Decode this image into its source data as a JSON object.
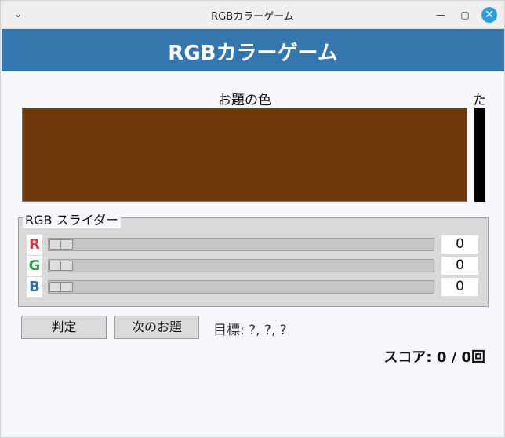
{
  "window": {
    "title": "RGBカラーゲーム",
    "menu_icon": "chevron-down-icon",
    "controls": [
      "minimize-icon",
      "maximize-icon",
      "close-icon"
    ]
  },
  "header": {
    "title": "RGBカラーゲーム"
  },
  "target": {
    "label": "お題の色",
    "color": "#6e3a07"
  },
  "side": {
    "label": "た",
    "color": "#000000"
  },
  "sliders": {
    "legend": "RGB スライダー",
    "channels": [
      {
        "letter": "R",
        "color": "#d9383e",
        "value": "0"
      },
      {
        "letter": "G",
        "color": "#2f9e4a",
        "value": "0"
      },
      {
        "letter": "B",
        "color": "#2f6fa8",
        "value": "0"
      }
    ]
  },
  "actions": {
    "judge_label": "判定",
    "next_label": "次のお題",
    "goal_text": "目標: ?, ?, ?"
  },
  "score": {
    "text": "スコア: 0 / 0回"
  }
}
